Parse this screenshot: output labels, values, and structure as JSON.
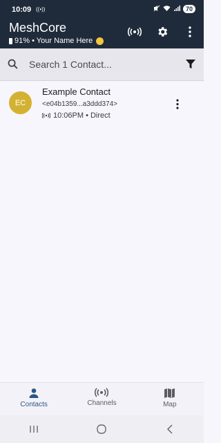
{
  "status_bar": {
    "time": "10:09",
    "battery": "70"
  },
  "app_bar": {
    "title": "MeshCore",
    "subtitle": "91% • Your Name Here"
  },
  "search": {
    "placeholder": "Search 1 Contact..."
  },
  "contacts": [
    {
      "initials": "EC",
      "name": "Example Contact",
      "key": "<e04b1359...a3ddd374>",
      "meta": "10:06PM • Direct",
      "avatar_color": "#d3b232"
    }
  ],
  "bottom_nav": {
    "items": [
      {
        "label": "Contacts",
        "active": true
      },
      {
        "label": "Channels",
        "active": false
      },
      {
        "label": "Map",
        "active": false
      }
    ]
  },
  "colors": {
    "header_bg": "#1f2b3a",
    "accent": "#2b5585"
  }
}
